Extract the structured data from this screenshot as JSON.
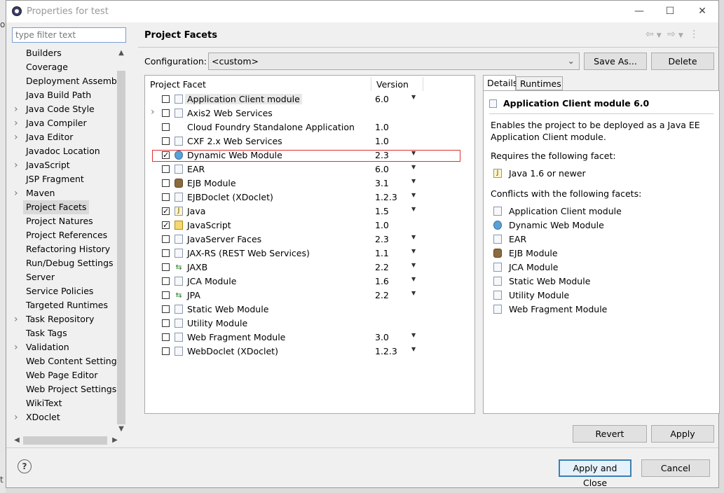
{
  "window": {
    "title": "Properties for test"
  },
  "filter": {
    "placeholder": "type filter text"
  },
  "tree": {
    "items": [
      {
        "label": "Builders",
        "expandable": false
      },
      {
        "label": "Coverage",
        "expandable": false
      },
      {
        "label": "Deployment Assembly",
        "expandable": false
      },
      {
        "label": "Java Build Path",
        "expandable": false
      },
      {
        "label": "Java Code Style",
        "expandable": true
      },
      {
        "label": "Java Compiler",
        "expandable": true
      },
      {
        "label": "Java Editor",
        "expandable": true
      },
      {
        "label": "Javadoc Location",
        "expandable": false
      },
      {
        "label": "JavaScript",
        "expandable": true
      },
      {
        "label": "JSP Fragment",
        "expandable": false
      },
      {
        "label": "Maven",
        "expandable": true
      },
      {
        "label": "Project Facets",
        "expandable": false,
        "selected": true
      },
      {
        "label": "Project Natures",
        "expandable": false
      },
      {
        "label": "Project References",
        "expandable": false
      },
      {
        "label": "Refactoring History",
        "expandable": false
      },
      {
        "label": "Run/Debug Settings",
        "expandable": false
      },
      {
        "label": "Server",
        "expandable": false
      },
      {
        "label": "Service Policies",
        "expandable": false
      },
      {
        "label": "Targeted Runtimes",
        "expandable": false
      },
      {
        "label": "Task Repository",
        "expandable": true
      },
      {
        "label": "Task Tags",
        "expandable": false
      },
      {
        "label": "Validation",
        "expandable": true
      },
      {
        "label": "Web Content Settings",
        "expandable": false
      },
      {
        "label": "Web Page Editor",
        "expandable": false
      },
      {
        "label": "Web Project Settings",
        "expandable": false
      },
      {
        "label": "WikiText",
        "expandable": false
      },
      {
        "label": "XDoclet",
        "expandable": true
      }
    ]
  },
  "panel": {
    "title": "Project Facets"
  },
  "configuration": {
    "label": "Configuration:",
    "value": "<custom>",
    "save_as": "Save As...",
    "delete": "Delete"
  },
  "facets": {
    "col_facet": "Project Facet",
    "col_version": "Version",
    "rows": [
      {
        "name": "Application Client module",
        "version": "6.0",
        "checked": false,
        "dropdown": true,
        "icon": "doc-icon",
        "highlighted": true
      },
      {
        "name": "Axis2 Web Services",
        "version": "",
        "checked": false,
        "dropdown": false,
        "icon": "doc-icon",
        "expandable": true
      },
      {
        "name": "Cloud Foundry Standalone Application",
        "version": "1.0",
        "checked": false,
        "dropdown": false,
        "icon": "none"
      },
      {
        "name": "CXF 2.x Web Services",
        "version": "1.0",
        "checked": false,
        "dropdown": false,
        "icon": "doc-icon"
      },
      {
        "name": "Dynamic Web Module",
        "version": "2.3",
        "checked": true,
        "dropdown": true,
        "icon": "globe-icon"
      },
      {
        "name": "EAR",
        "version": "6.0",
        "checked": false,
        "dropdown": true,
        "icon": "doc-icon"
      },
      {
        "name": "EJB Module",
        "version": "3.1",
        "checked": false,
        "dropdown": true,
        "icon": "bean-icon"
      },
      {
        "name": "EJBDoclet (XDoclet)",
        "version": "1.2.3",
        "checked": false,
        "dropdown": true,
        "icon": "doc-icon"
      },
      {
        "name": "Java",
        "version": "1.5",
        "checked": true,
        "dropdown": true,
        "icon": "java-file-icon"
      },
      {
        "name": "JavaScript",
        "version": "1.0",
        "checked": true,
        "dropdown": false,
        "icon": "lock-icon"
      },
      {
        "name": "JavaServer Faces",
        "version": "2.3",
        "checked": false,
        "dropdown": true,
        "icon": "doc-icon"
      },
      {
        "name": "JAX-RS (REST Web Services)",
        "version": "1.1",
        "checked": false,
        "dropdown": true,
        "icon": "doc-icon"
      },
      {
        "name": "JAXB",
        "version": "2.2",
        "checked": false,
        "dropdown": true,
        "icon": "arrows-icon"
      },
      {
        "name": "JCA Module",
        "version": "1.6",
        "checked": false,
        "dropdown": true,
        "icon": "doc-icon"
      },
      {
        "name": "JPA",
        "version": "2.2",
        "checked": false,
        "dropdown": true,
        "icon": "arrows-icon"
      },
      {
        "name": "Static Web Module",
        "version": "",
        "checked": false,
        "dropdown": false,
        "icon": "doc-icon"
      },
      {
        "name": "Utility Module",
        "version": "",
        "checked": false,
        "dropdown": false,
        "icon": "doc-icon"
      },
      {
        "name": "Web Fragment Module",
        "version": "3.0",
        "checked": false,
        "dropdown": true,
        "icon": "doc-icon"
      },
      {
        "name": "WebDoclet (XDoclet)",
        "version": "1.2.3",
        "checked": false,
        "dropdown": true,
        "icon": "doc-icon"
      }
    ]
  },
  "tabs": {
    "details": "Details",
    "runtimes": "Runtimes"
  },
  "details": {
    "heading": "Application Client module 6.0",
    "description_line1": "Enables the project to be deployed as a Java EE",
    "description_line2": "Application Client module.",
    "requires_label": "Requires the following facet:",
    "requires": [
      {
        "name": "Java 1.6 or newer",
        "icon": "java-file-icon"
      }
    ],
    "conflicts_label": "Conflicts with the following facets:",
    "conflicts": [
      {
        "name": "Application Client module",
        "icon": "doc-icon"
      },
      {
        "name": "Dynamic Web Module",
        "icon": "globe-icon"
      },
      {
        "name": "EAR",
        "icon": "doc-icon"
      },
      {
        "name": "EJB Module",
        "icon": "bean-icon"
      },
      {
        "name": "JCA Module",
        "icon": "doc-icon"
      },
      {
        "name": "Static Web Module",
        "icon": "doc-icon"
      },
      {
        "name": "Utility Module",
        "icon": "doc-icon"
      },
      {
        "name": "Web Fragment Module",
        "icon": "doc-icon"
      }
    ]
  },
  "buttons": {
    "revert": "Revert",
    "apply": "Apply",
    "apply_close": "Apply and Close",
    "cancel": "Cancel"
  },
  "background_fragments": [
    "or",
    "t"
  ]
}
